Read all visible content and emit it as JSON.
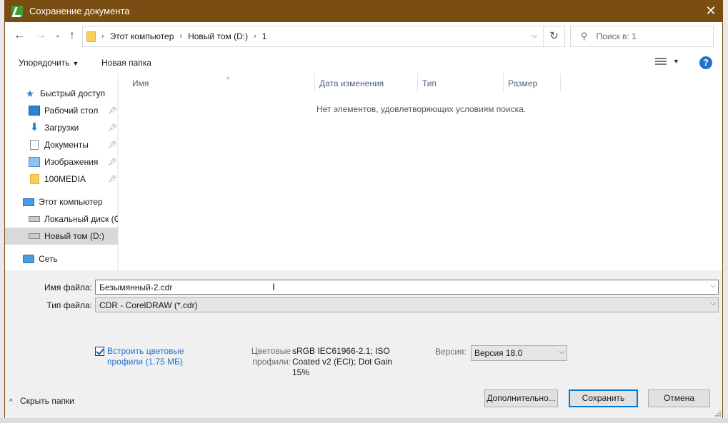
{
  "window": {
    "title": "Сохранение документа"
  },
  "address": {
    "crumbs": [
      "Этот компьютер",
      "Новый том (D:)",
      "1"
    ]
  },
  "search": {
    "placeholder": "Поиск в: 1"
  },
  "toolbar": {
    "organize_label": "Упорядочить",
    "new_folder_label": "Новая папка"
  },
  "sidebar": {
    "items": [
      {
        "label": "Быстрый доступ",
        "icon": "star-icon",
        "pinned": false
      },
      {
        "label": "Рабочий стол",
        "icon": "desktop-icon",
        "pinned": true
      },
      {
        "label": "Загрузки",
        "icon": "download-icon",
        "pinned": true
      },
      {
        "label": "Документы",
        "icon": "documents-icon",
        "pinned": true
      },
      {
        "label": "Изображения",
        "icon": "pictures-icon",
        "pinned": true
      },
      {
        "label": "100MEDIA",
        "icon": "folder-icon",
        "pinned": true
      },
      {
        "label": "Этот компьютер",
        "icon": "computer-icon",
        "pinned": false
      },
      {
        "label": "Локальный диск (C",
        "icon": "local-disk-icon",
        "pinned": false
      },
      {
        "label": "Новый том (D:)",
        "icon": "drive-icon",
        "pinned": false,
        "selected": true
      },
      {
        "label": "Сеть",
        "icon": "network-icon",
        "pinned": false
      }
    ]
  },
  "filelist": {
    "columns": [
      "Имя",
      "Дата изменения",
      "Тип",
      "Размер"
    ],
    "empty_message": "Нет элементов, удовлетворяющих условиям поиска."
  },
  "form": {
    "filename_label": "Имя файла:",
    "filename_value": "Безымянный-2.cdr",
    "filetype_label": "Тип файла:",
    "filetype_value": "CDR - CorelDRAW (*.cdr)",
    "embed_profiles_label": "Встроить цветовые профили (1.75 МБ)",
    "embed_profiles_checked": true,
    "color_profiles_label": "Цветовые профили:",
    "color_profiles_value": "sRGB IEC61966-2.1; ISO Coated v2 (ECI); Dot Gain 15%",
    "version_label": "Версия:",
    "version_value": "Версия 18.0"
  },
  "footer": {
    "hide_folders_label": "Скрыть папки",
    "advanced_label": "Дополнительно...",
    "save_label": "Сохранить",
    "cancel_label": "Отмена"
  },
  "colors": {
    "titlebar": "#7a4e13",
    "accent": "#0078d7",
    "link": "#1f6fd1"
  }
}
